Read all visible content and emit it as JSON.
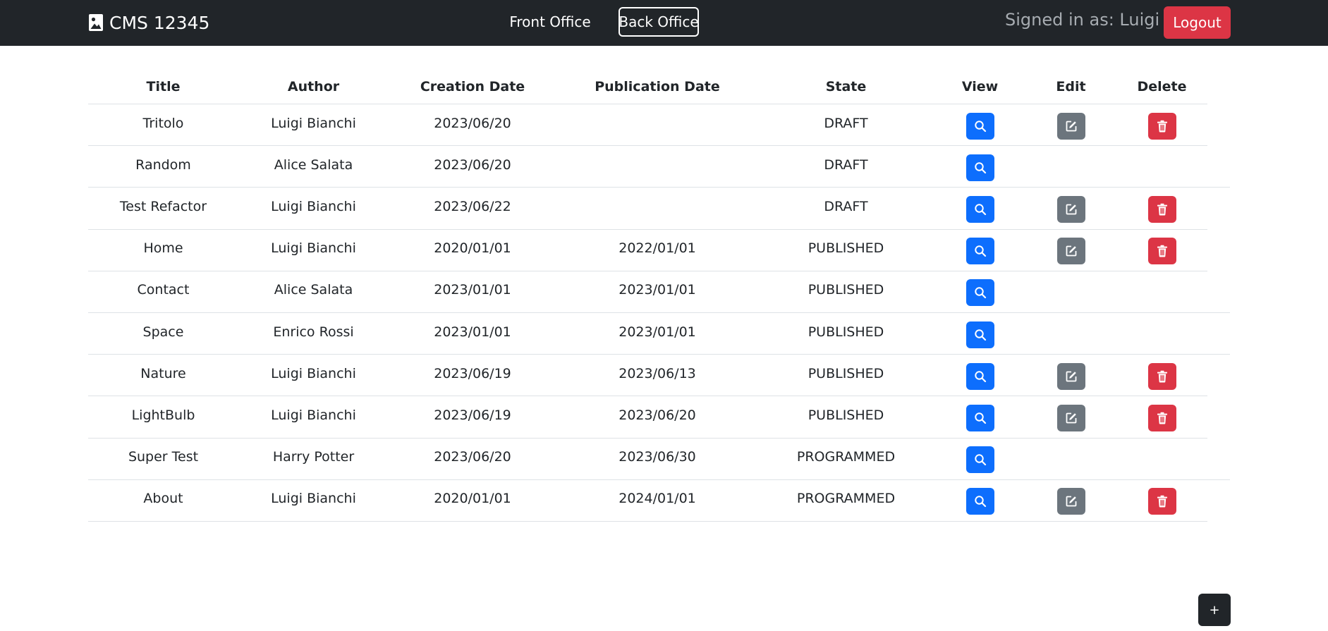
{
  "navbar": {
    "brand": "CMS 12345",
    "brand_icon": "image-icon",
    "links": [
      "Front Office",
      "Back Office"
    ],
    "active_link": "Back Office",
    "signed_in": "Signed in as: Luigi",
    "logout_label": "Logout"
  },
  "table": {
    "headers": [
      "Title",
      "Author",
      "Creation Date",
      "Publication Date",
      "State",
      "View",
      "Edit",
      "Delete"
    ],
    "rows": [
      {
        "title": "Tritolo",
        "author": "Luigi Bianchi",
        "created": "2023/06/20",
        "published": "",
        "state": "DRAFT",
        "can_edit": true
      },
      {
        "title": "Random",
        "author": "Alice Salata",
        "created": "2023/06/20",
        "published": "",
        "state": "DRAFT",
        "can_edit": false
      },
      {
        "title": "Test Refactor",
        "author": "Luigi Bianchi",
        "created": "2023/06/22",
        "published": "",
        "state": "DRAFT",
        "can_edit": true
      },
      {
        "title": "Home",
        "author": "Luigi Bianchi",
        "created": "2020/01/01",
        "published": "2022/01/01",
        "state": "PUBLISHED",
        "can_edit": true
      },
      {
        "title": "Contact",
        "author": "Alice Salata",
        "created": "2023/01/01",
        "published": "2023/01/01",
        "state": "PUBLISHED",
        "can_edit": false
      },
      {
        "title": "Space",
        "author": "Enrico Rossi",
        "created": "2023/01/01",
        "published": "2023/01/01",
        "state": "PUBLISHED",
        "can_edit": false
      },
      {
        "title": "Nature",
        "author": "Luigi Bianchi",
        "created": "2023/06/19",
        "published": "2023/06/13",
        "state": "PUBLISHED",
        "can_edit": true
      },
      {
        "title": "LightBulb",
        "author": "Luigi Bianchi",
        "created": "2023/06/19",
        "published": "2023/06/20",
        "state": "PUBLISHED",
        "can_edit": true
      },
      {
        "title": "Super Test",
        "author": "Harry Potter",
        "created": "2023/06/20",
        "published": "2023/06/30",
        "state": "PROGRAMMED",
        "can_edit": false
      },
      {
        "title": "About",
        "author": "Luigi Bianchi",
        "created": "2020/01/01",
        "published": "2024/01/01",
        "state": "PROGRAMMED",
        "can_edit": true
      }
    ],
    "icons": {
      "view": "search-icon",
      "edit": "edit-icon",
      "delete": "trash-icon"
    }
  },
  "add_button_label": "+",
  "colors": {
    "navbar": "#212529",
    "primary": "#0d6efd",
    "secondary": "#6c757d",
    "danger": "#dc3545"
  }
}
